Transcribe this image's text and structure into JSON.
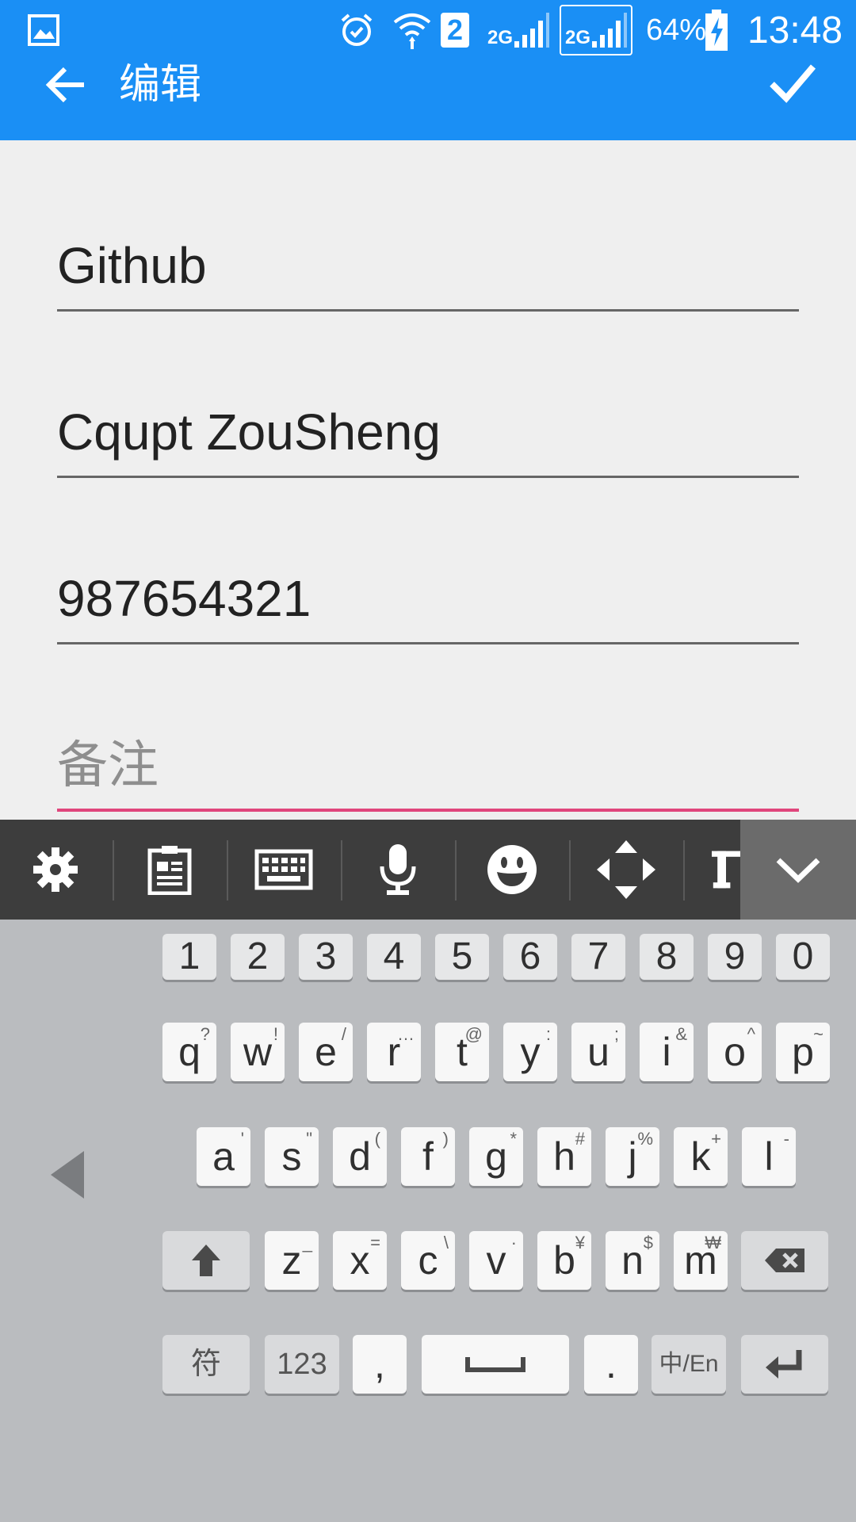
{
  "status_bar": {
    "sim_number": "2",
    "network1": "2G",
    "network2": "2G",
    "battery": "64%",
    "time": "13:48"
  },
  "toolbar": {
    "title": "编辑"
  },
  "form": {
    "fields": [
      {
        "value": "Github",
        "placeholder": ""
      },
      {
        "value": "Cqupt ZouSheng",
        "placeholder": ""
      },
      {
        "value": "987654321",
        "placeholder": ""
      },
      {
        "value": "",
        "placeholder": "备注"
      }
    ]
  },
  "keyboard": {
    "numbers": [
      "1",
      "2",
      "3",
      "4",
      "5",
      "6",
      "7",
      "8",
      "9",
      "0"
    ],
    "row1": [
      {
        "k": "q",
        "s": "?"
      },
      {
        "k": "w",
        "s": "!"
      },
      {
        "k": "e",
        "s": "/"
      },
      {
        "k": "r",
        "s": "…"
      },
      {
        "k": "t",
        "s": "@"
      },
      {
        "k": "y",
        "s": ":"
      },
      {
        "k": "u",
        "s": ";"
      },
      {
        "k": "i",
        "s": "&"
      },
      {
        "k": "o",
        "s": "^"
      },
      {
        "k": "p",
        "s": "~"
      }
    ],
    "row2": [
      {
        "k": "a",
        "s": "'"
      },
      {
        "k": "s",
        "s": "\""
      },
      {
        "k": "d",
        "s": "("
      },
      {
        "k": "f",
        "s": ")"
      },
      {
        "k": "g",
        "s": "*"
      },
      {
        "k": "h",
        "s": "#"
      },
      {
        "k": "j",
        "s": "%"
      },
      {
        "k": "k",
        "s": "+"
      },
      {
        "k": "l",
        "s": "-"
      }
    ],
    "row3": [
      {
        "k": "z",
        "s": "_"
      },
      {
        "k": "x",
        "s": "="
      },
      {
        "k": "c",
        "s": "\\"
      },
      {
        "k": "v",
        "s": "·"
      },
      {
        "k": "b",
        "s": "¥"
      },
      {
        "k": "n",
        "s": "$"
      },
      {
        "k": "m",
        "s": "₩"
      }
    ],
    "symbols_label": "符",
    "numeric_label": "123",
    "comma_label": ",",
    "period_label": ".",
    "lang_label": "中/En"
  }
}
